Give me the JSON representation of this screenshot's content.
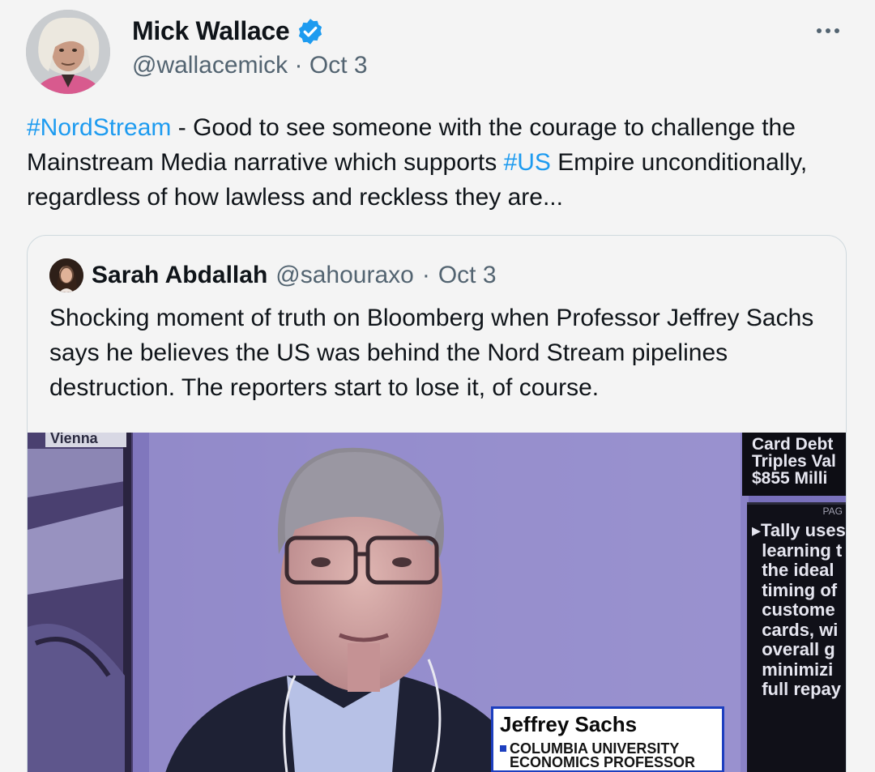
{
  "author": {
    "display_name": "Mick Wallace",
    "handle": "@wallacemick",
    "date": "Oct 3",
    "separator": "·",
    "verified": true
  },
  "tweet": {
    "hashtag_1": "#NordStream",
    "text_1": " - Good to see someone with the courage to challenge the Mainstream Media narrative which supports  ",
    "hashtag_2": "#US",
    "text_2": " Empire unconditionally, regardless of how lawless and reckless they are..."
  },
  "quote": {
    "display_name": "Sarah Abdallah",
    "handle": "@sahouraxo",
    "separator": "·",
    "date": "Oct 3",
    "text": "Shocking moment of truth on Bloomberg when Professor Jeffrey Sachs says he believes the US was behind the Nord Stream pipelines destruction. The reporters start to lose it, of course."
  },
  "video": {
    "location_label": "Vienna",
    "ticker_top": "Card Debt\nTriples Val\n$855 Milli",
    "ticker_page": "PAG",
    "ticker_side": "▸Tally uses\n  learning t\n  the ideal\n  timing of\n  custome\n  cards, wi\n  overall g\n  minimizi\n  full repay",
    "lower_third_name": "Jeffrey Sachs",
    "lower_third_title_1": "COLUMBIA UNIVERSITY",
    "lower_third_title_2": "ECONOMICS PROFESSOR"
  },
  "icons": {
    "verified": "verified-badge-icon",
    "more": "more-options-icon"
  },
  "colors": {
    "accent": "#1d9bf0",
    "muted": "#536471",
    "text": "#0f1419"
  }
}
